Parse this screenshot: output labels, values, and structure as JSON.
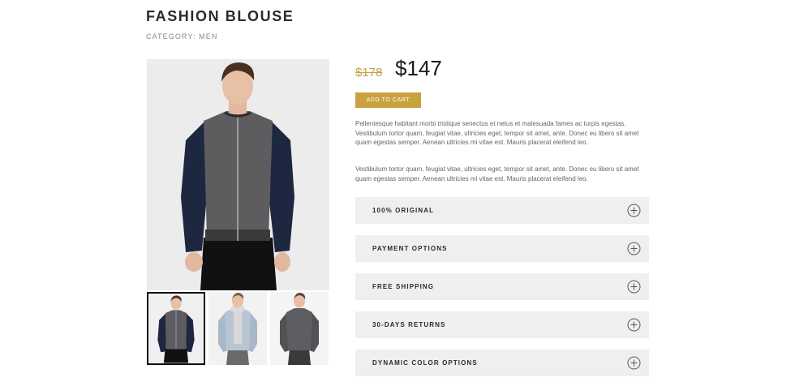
{
  "product": {
    "title": "FASHION BLOUSE",
    "category": "CATEGORY: MEN"
  },
  "pricing": {
    "old_price": "$178",
    "new_price": "$147"
  },
  "actions": {
    "add_to_cart": "ADD TO CART"
  },
  "description": [
    "Pellentesque habitant morbi tristique senectus et netus et malesuada fames ac turpis egestas. Vestibulum tortor quam, feugiat vitae, ultricies eget, tempor sit amet, ante. Donec eu libero sit amet quam egestas semper. Aenean ultricies mi vitae est. Mauris placerat eleifend leo.",
    "Vestibulum tortor quam, feugiat vitae, ultricies eget, tempor sit amet, ante. Donec eu libero sit amet quam egestas semper. Aenean ultricies mi vitae est. Mauris placerat eleifend leo."
  ],
  "accordion": [
    {
      "label": "100% ORIGINAL",
      "icon": "plus-circle-icon"
    },
    {
      "label": "PAYMENT OPTIONS",
      "icon": "plus-circle-icon"
    },
    {
      "label": "FREE SHIPPING",
      "icon": "plus-circle-icon"
    },
    {
      "label": "30-DAYS RETURNS",
      "icon": "plus-circle-icon"
    },
    {
      "label": "DYNAMIC COLOR OPTIONS",
      "icon": "plus-circle-icon"
    }
  ],
  "colors": {
    "accent": "#c9a23f",
    "old_price": "#c8a04a",
    "accordion_bg": "#efefef"
  }
}
